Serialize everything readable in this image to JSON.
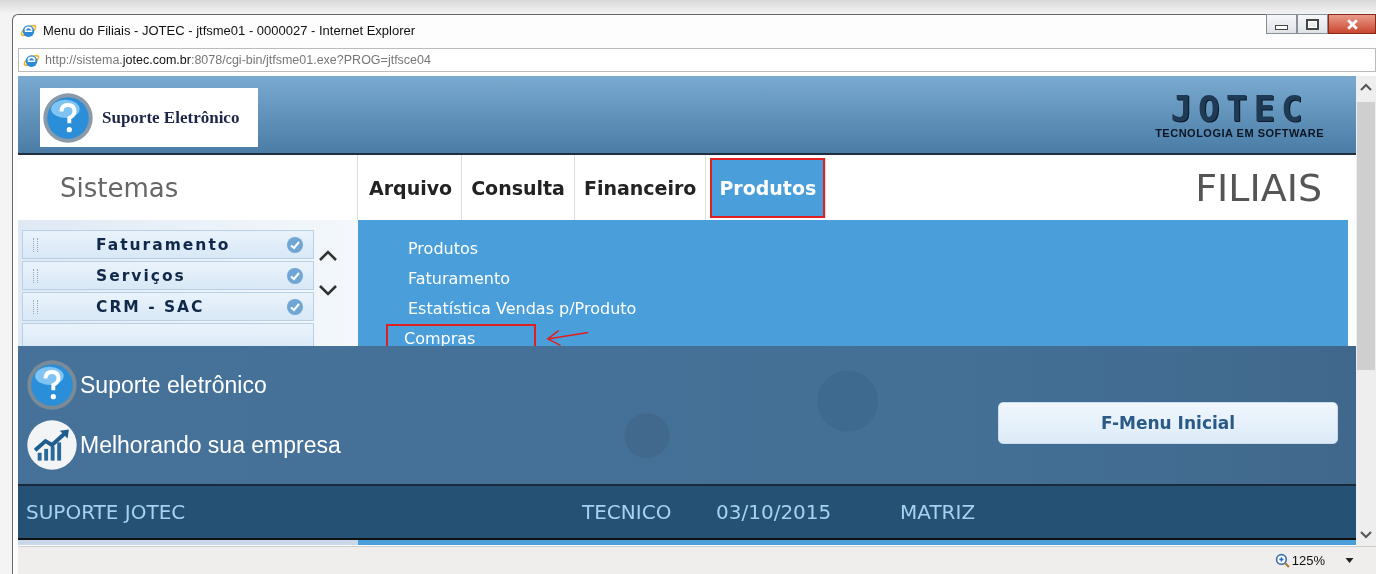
{
  "window": {
    "title": "Menu do Filiais - JOTEC - jtfsme01 - 0000027 - Internet Explorer",
    "address": "http://sistema.**jotec.com.br**:8078/cgi-bin/jtfsme01.exe?PROG=jtfsce04"
  },
  "header": {
    "logo_text": "Suporte Eletrônico",
    "brand": "JOTEC",
    "brand_tagline": "TECNOLOGIA EM SOFTWARE"
  },
  "sidebar": {
    "title": "Sistemas",
    "items": [
      {
        "label": "Faturamento",
        "checked": true
      },
      {
        "label": "Serviços",
        "checked": true
      },
      {
        "label": "CRM - SAC",
        "checked": true
      }
    ]
  },
  "menu": {
    "items": [
      {
        "label": "Arquivo",
        "selected": false,
        "highlighted": false
      },
      {
        "label": "Consulta",
        "selected": false,
        "highlighted": false
      },
      {
        "label": "Financeiro",
        "selected": false,
        "highlighted": false
      },
      {
        "label": "Produtos",
        "selected": true,
        "highlighted": true
      }
    ],
    "module": "FILIAIS"
  },
  "dropdown": {
    "items": [
      {
        "label": "Produtos",
        "highlighted": false
      },
      {
        "label": "Faturamento",
        "highlighted": false
      },
      {
        "label": "Estatística Vendas p/Produto",
        "highlighted": false
      },
      {
        "label": "Compras",
        "highlighted": true
      }
    ]
  },
  "support": {
    "links": [
      {
        "kind": "help",
        "label": "Suporte eletrônico"
      },
      {
        "kind": "growth",
        "label": "Melhorando sua empresa"
      }
    ],
    "button": "F-Menu Inicial"
  },
  "footer": {
    "user": "SUPORTE JOTEC",
    "role": "TECNICO",
    "date": "03/10/2015",
    "branch": "MATRIZ"
  },
  "status_bar": {
    "zoom": "125%"
  }
}
